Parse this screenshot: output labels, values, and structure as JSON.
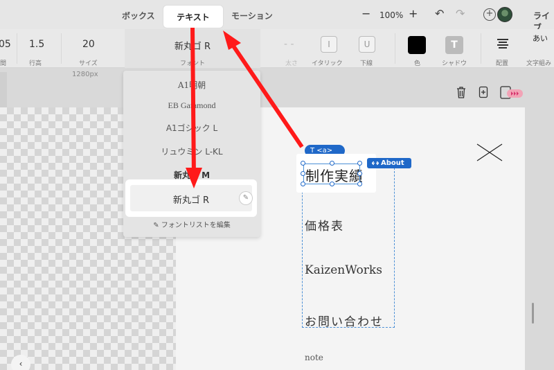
{
  "tabs": {
    "box": "ボックス",
    "text": "テキスト",
    "motion": "モーション"
  },
  "header": {
    "zoom_minus": "−",
    "zoom_level": "100%",
    "zoom_plus": "+",
    "undo": "↶",
    "redo": "↷",
    "add_user": "+",
    "live": "ライブ"
  },
  "toolbar": {
    "letter_spacing_value": "05",
    "letter_spacing_label": "間",
    "line_height_value": "1.5",
    "line_height_label": "行高",
    "size_value": "20",
    "size_label": "サイズ",
    "font_value": "新丸ゴ R",
    "font_label": "フォント",
    "bold_value": "- -",
    "bold_label": "太さ",
    "italic_icon": "I",
    "italic_label": "イタリック",
    "underline_icon": "U",
    "underline_label": "下線",
    "color_label": "色",
    "color_value": "#000000",
    "shadow_icon": "T",
    "shadow_label": "シャドウ",
    "align_label": "配置",
    "vertical_icon": "あい",
    "vertical_label": "文字組み"
  },
  "workspace": {
    "ruler_label": "1280px",
    "collapse": "‹"
  },
  "font_dropdown": {
    "options": [
      "A1明朝",
      "EB Garamond",
      "A1ゴシック L",
      "リュウミン L-KL",
      "新丸ゴ M"
    ],
    "selected": "新丸ゴ R",
    "edit_pencil": "✎",
    "edit_list": "✎ フォントリストを編集"
  },
  "artboard": {
    "selected_text": "制作実績",
    "tag_a": "T  <a>",
    "about_tag": "About",
    "menu": [
      "価格表",
      "KaizenWorks",
      "お問い合わせ",
      "note"
    ]
  },
  "colors": {
    "accent_blue": "#1f68c8",
    "arrow_red": "#ff1a1a"
  }
}
